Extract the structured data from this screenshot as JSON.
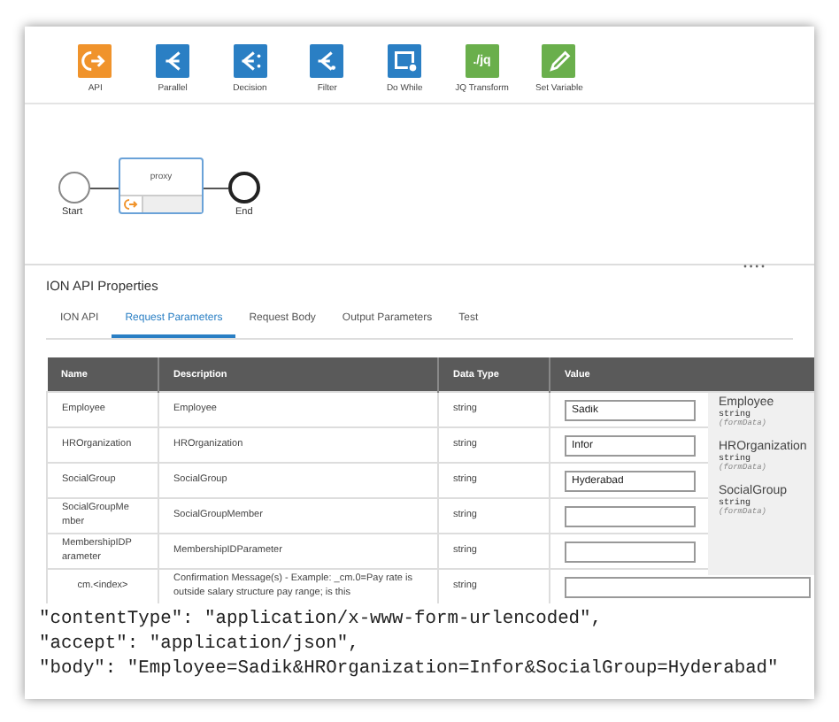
{
  "toolbar": {
    "items": [
      {
        "kind": "api",
        "label": "API"
      },
      {
        "kind": "parallel",
        "label": "Parallel"
      },
      {
        "kind": "decision",
        "label": "Decision"
      },
      {
        "kind": "filter",
        "label": "Filter"
      },
      {
        "kind": "dowhile",
        "label": "Do While"
      },
      {
        "kind": "jq",
        "label": "JQ Transform",
        "glyph": "./jq"
      },
      {
        "kind": "variable",
        "label": "Set Variable"
      }
    ]
  },
  "diagram": {
    "start": "Start",
    "task": "proxy",
    "end": "End"
  },
  "properties": {
    "title": "ION API Properties",
    "tabs": [
      {
        "label": "ION API",
        "selected": false
      },
      {
        "label": "Request Parameters",
        "selected": true
      },
      {
        "label": "Request Body",
        "selected": false
      },
      {
        "label": "Output Parameters",
        "selected": false
      },
      {
        "label": "Test",
        "selected": false
      }
    ],
    "table": {
      "columns": [
        "Name",
        "Description",
        "Data Type",
        "Value"
      ],
      "rows": [
        {
          "name": "Employee",
          "description": "Employee",
          "data_type": "string",
          "value": "Sadik"
        },
        {
          "name": "HROrganization",
          "description": "HROrganization",
          "data_type": "string",
          "value": "Infor"
        },
        {
          "name": "SocialGroup",
          "description": "SocialGroup",
          "data_type": "string",
          "value": "Hyderabad"
        },
        {
          "name": "SocialGroupMe mber",
          "description": "SocialGroupMember",
          "data_type": "string"
        },
        {
          "name": "MembershipIDP arameter",
          "description": "MembershipIDParameter",
          "data_type": "string"
        },
        {
          "name": "cm.<index>",
          "description": "Confirmation Message(s) - Example: _cm.0=Pay rate is outside salary structure pay range; is this",
          "data_type": "string"
        }
      ]
    }
  },
  "param_panel": {
    "items": [
      {
        "name": "Employee",
        "type": "string",
        "location": "(formData)"
      },
      {
        "name": "HROrganization",
        "type": "string",
        "location": "(formData)"
      },
      {
        "name": "SocialGroup",
        "type": "string",
        "location": "(formData)"
      }
    ]
  },
  "code": {
    "lines": [
      "\"contentType\": \"application/x-www-form-urlencoded\",",
      "\"accept\": \"application/json\",",
      "\"body\": \"Employee=Sadik&HROrganization=Infor&SocialGroup=Hyderabad\""
    ]
  }
}
